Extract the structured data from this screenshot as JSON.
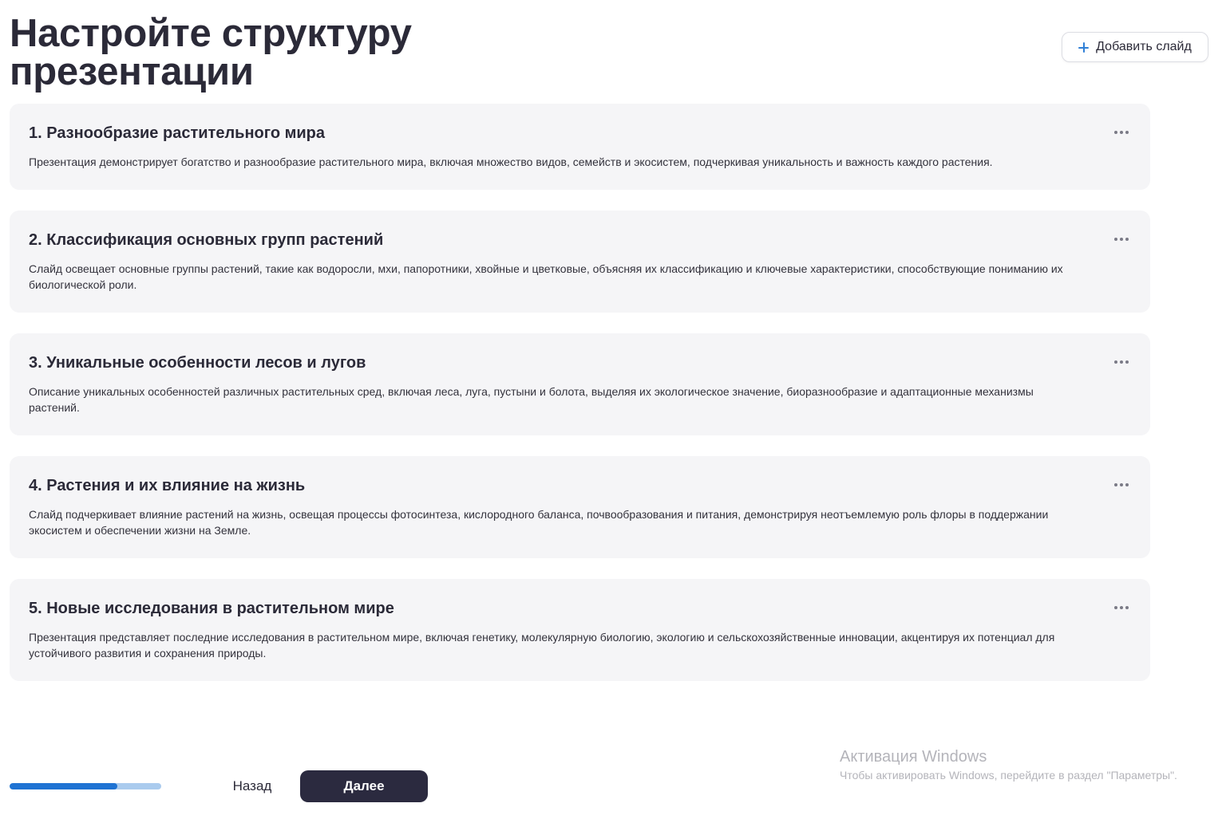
{
  "header": {
    "title": "Настройте структуру презентации",
    "add_slide_label": "Добавить слайд",
    "add_slide_icon": "plus-icon"
  },
  "slides": [
    {
      "title": "1. Разнообразие растительного мира",
      "description": "Презентация демонстрирует богатство и разнообразие растительного мира, включая множество видов, семейств и экосистем, подчеркивая уникальность и важность каждого растения."
    },
    {
      "title": "2. Классификация основных групп растений",
      "description": "Слайд освещает основные группы растений, такие как водоросли, мхи, папоротники, хвойные и цветковые, объясняя их классификацию и ключевые характеристики, способствующие пониманию их биологической роли."
    },
    {
      "title": "3. Уникальные особенности лесов и лугов",
      "description": "Описание уникальных особенностей различных растительных сред, включая леса, луга, пустыни и болота, выделяя их экологическое значение, биоразнообразие и адаптационные механизмы растений."
    },
    {
      "title": "4. Растения и их влияние на жизнь",
      "description": "Слайд подчеркивает влияние растений на жизнь, освещая процессы фотосинтеза, кислородного баланса, почвообразования и питания, демонстрируя неотъемлемую роль флоры в поддержании экосистем и обеспечении жизни на Земле."
    },
    {
      "title": "5. Новые исследования в растительном мире",
      "description": "Презентация представляет последние исследования в растительном мире, включая генетику, молекулярную биологию, экологию и сельскохозяйственные инновации, акцентируя их потенциал для устойчивого развития и сохранения природы."
    }
  ],
  "footer": {
    "progress_fraction": 0.71,
    "back_label": "Назад",
    "next_label": "Далее"
  },
  "watermark": {
    "title": "Активация Windows",
    "subtitle": "Чтобы активировать Windows, перейдите в раздел \"Параметры\"."
  },
  "colors": {
    "accent": "#1f73d3",
    "progress_track": "#aacbee",
    "primary_button": "#2b2a3f",
    "card_background": "#f5f5f7"
  }
}
